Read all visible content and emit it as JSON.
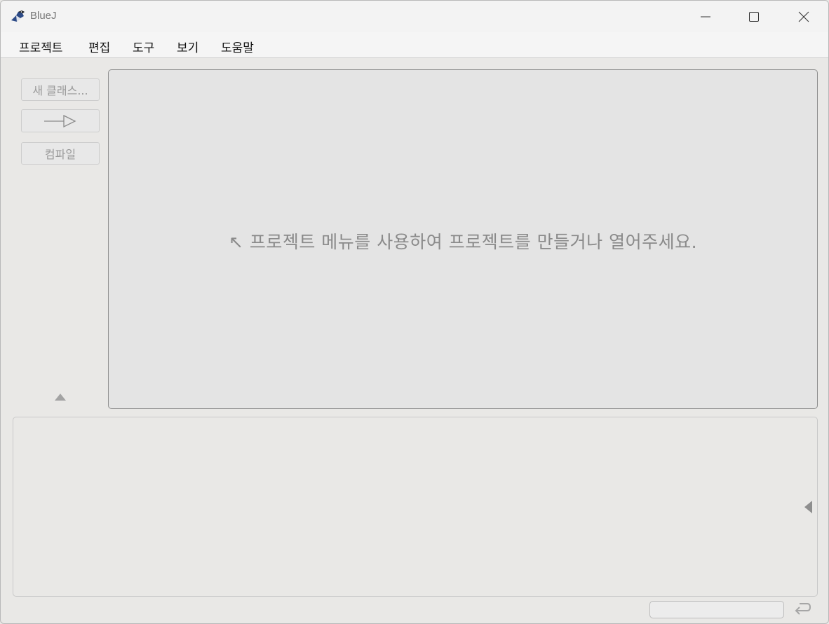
{
  "window": {
    "title": "BlueJ"
  },
  "menu": {
    "items": [
      "프로젝트",
      "편집",
      "도구",
      "보기",
      "도움말"
    ]
  },
  "sidebar": {
    "new_class_label": "새 클래스...",
    "compile_label": "컴파일"
  },
  "canvas": {
    "hint": "↖ 프로젝트 메뉴를 사용하여 프로젝트를 만들거나 열어주세요."
  },
  "icons": {
    "app": "bluej-bird-icon",
    "minimize": "minimize-icon",
    "maximize": "maximize-icon",
    "close": "close-icon",
    "arrow": "inheritance-arrow-icon",
    "expand_up": "triangle-up-icon",
    "expand_left": "triangle-left-icon",
    "return": "return-arrow-icon"
  },
  "colors": {
    "background": "#e9e8e6",
    "canvas": "#e4e4e4",
    "disabled_text": "#9a9a9a"
  }
}
